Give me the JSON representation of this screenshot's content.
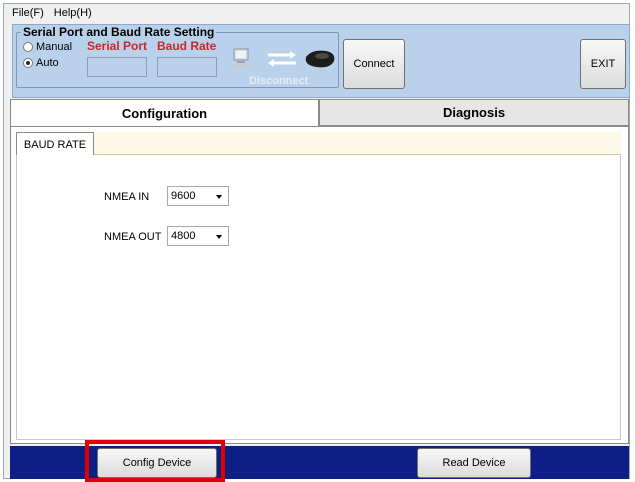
{
  "menu": {
    "file": "File(F)",
    "help": "Help(H)"
  },
  "serial": {
    "group_title": "Serial Port and Baud Rate Setting",
    "mode_manual": "Manual",
    "mode_auto": "Auto",
    "selected_mode": "Auto",
    "serial_port_label": "Serial Port",
    "baud_rate_label": "Baud Rate",
    "serial_port_value": "",
    "baud_rate_value": "",
    "connection_status": "Disconnect"
  },
  "toolbar": {
    "connect_label": "Connect",
    "exit_label": "EXIT"
  },
  "tabs": {
    "configuration": "Configuration",
    "diagnosis": "Diagnosis",
    "active": "Configuration"
  },
  "subtab": {
    "baud_rate": "BAUD RATE"
  },
  "form": {
    "nmea_in_label": "NMEA IN",
    "nmea_in_value": "9600",
    "nmea_out_label": "NMEA OUT",
    "nmea_out_value": "4800"
  },
  "footer": {
    "config_device_label": "Config Device",
    "read_device_label": "Read Device"
  },
  "colors": {
    "panel_blue": "#b9d1ea",
    "footer_navy": "#0d1f86",
    "label_red": "#c62828",
    "highlight_red": "#e00000"
  }
}
